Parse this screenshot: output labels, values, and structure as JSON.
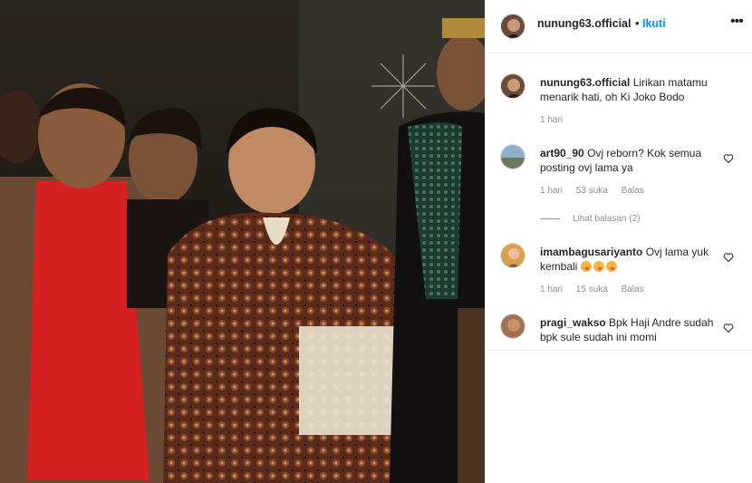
{
  "post": {
    "author": "nunung63.official",
    "follow_label": "Ikuti",
    "dot": "•",
    "more": "•••"
  },
  "caption": {
    "user": "nunung63.official",
    "text": "Lirikan matamu menarik hati, oh Ki Joko Bodo",
    "time": "1 hari"
  },
  "comments": [
    {
      "user": "art90_90",
      "text": "Ovj reborn? Kok semua posting ovj lama ya",
      "time": "1 hari",
      "likes": "53 suka",
      "reply": "Balas",
      "view_replies": "Lihat balasan (2)"
    },
    {
      "user": "imambagusariyanto",
      "text": "Ovj lama yuk kembali",
      "emoji_count": 3,
      "time": "1 hari",
      "likes": "15 suka",
      "reply": "Balas"
    },
    {
      "user": "pragi_wakso",
      "text": "Bpk Haji Andre sudah bpk sule sudah ini momi"
    }
  ],
  "colors": {
    "accent": "#0095f6",
    "text": "#262626",
    "muted": "#8e8e8e",
    "divider": "#efefef"
  }
}
